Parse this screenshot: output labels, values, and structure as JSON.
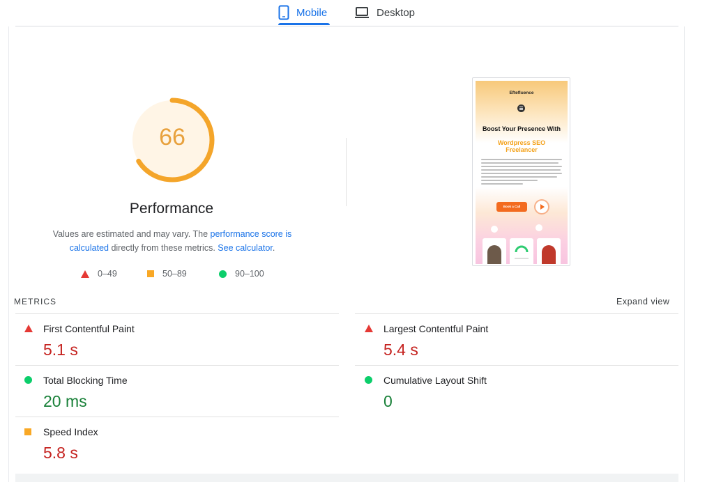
{
  "tabs": {
    "mobile": "Mobile",
    "desktop": "Desktop"
  },
  "colors": {
    "accent": "#1a73e8",
    "average": "#e8a13d",
    "fail": "#e53935",
    "pass": "#0cce6b",
    "fail_text": "#c5221f",
    "pass_text": "#188038"
  },
  "score": {
    "value": "66",
    "fraction": 0.66,
    "title": "Performance",
    "desc_pre": "Values are estimated and may vary. The ",
    "desc_link1": "performance score is calculated",
    "desc_mid": " directly from these metrics. ",
    "desc_link2": "See calculator",
    "desc_post": "."
  },
  "legend": {
    "fail": "0–49",
    "average": "50–89",
    "pass": "90–100"
  },
  "preview": {
    "logo": "Eftefluence",
    "heading": "Boost Your Presence With",
    "highlight": "Wordpress SEO Freelancer",
    "button": "Book a Call"
  },
  "metrics": {
    "label": "METRICS",
    "expand": "Expand view",
    "items": [
      {
        "name": "First Contentful Paint",
        "value": "5.1 s",
        "status": "fail"
      },
      {
        "name": "Largest Contentful Paint",
        "value": "5.4 s",
        "status": "fail"
      },
      {
        "name": "Total Blocking Time",
        "value": "20 ms",
        "status": "pass"
      },
      {
        "name": "Cumulative Layout Shift",
        "value": "0",
        "status": "pass"
      },
      {
        "name": "Speed Index",
        "value": "5.8 s",
        "status": "average"
      }
    ]
  }
}
